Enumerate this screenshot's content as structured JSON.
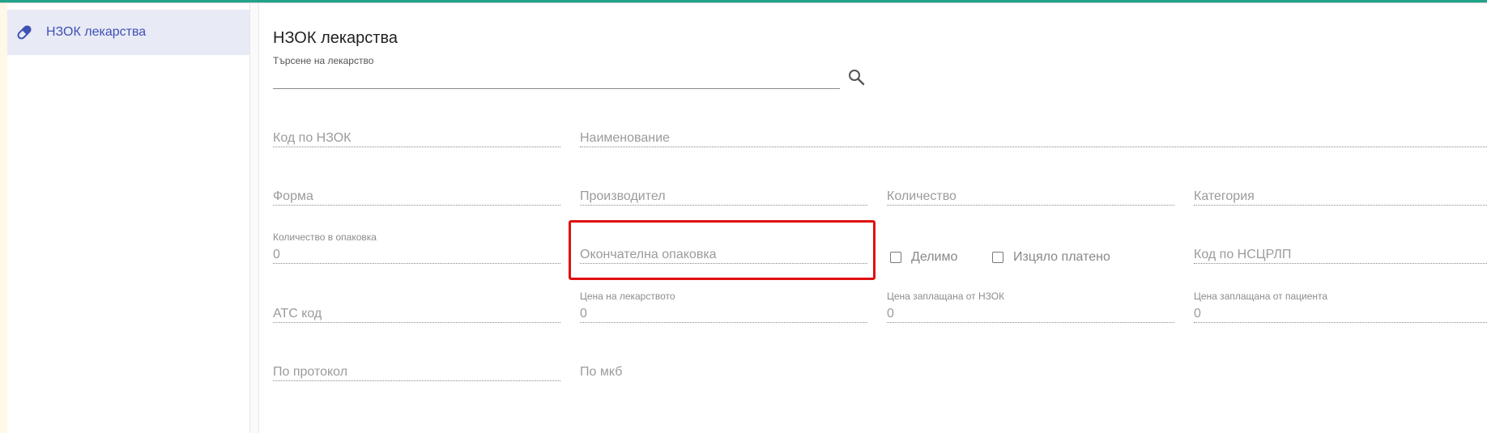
{
  "sidebar": {
    "items": [
      {
        "label": "НЗОК лекарства",
        "icon": "pill-icon",
        "active": true
      }
    ]
  },
  "page": {
    "title": "НЗОК лекарства",
    "search": {
      "label": "Търсене на лекарство",
      "value": "",
      "icon": "search-icon"
    }
  },
  "fields": {
    "nzok_code": {
      "label": "Код по НЗОК",
      "value": ""
    },
    "name": {
      "label": "Наименование",
      "value": ""
    },
    "form": {
      "label": "Форма",
      "value": ""
    },
    "manufacturer": {
      "label": "Производител",
      "value": ""
    },
    "quantity": {
      "label": "Количество",
      "value": ""
    },
    "category": {
      "label": "Категория",
      "value": ""
    },
    "qty_in_pack": {
      "label": "Количество в опаковка",
      "value": "0"
    },
    "final_pack": {
      "label": "Окончателна опаковка",
      "value": ""
    },
    "divisible": {
      "label": "Делимо",
      "checked": false
    },
    "fully_paid": {
      "label": "Изцяло платено",
      "checked": false
    },
    "nscrlp_code": {
      "label": "Код по НСЦРЛП",
      "value": ""
    },
    "atc_code": {
      "label": "АТС код",
      "value": ""
    },
    "drug_price": {
      "label": "Цена на лекарството",
      "value": "0"
    },
    "nzok_paid": {
      "label": "Цена заплащана от НЗОК",
      "value": "0"
    },
    "patient_paid": {
      "label": "Цена заплащана от пациента",
      "value": "0"
    },
    "protocol": {
      "label": "По протокол",
      "value": ""
    },
    "mkb": {
      "label": "По мкб",
      "value": ""
    }
  },
  "colors": {
    "accent": "#3f51b5",
    "topbar": "#1fa38a",
    "highlight": "#e01010"
  }
}
